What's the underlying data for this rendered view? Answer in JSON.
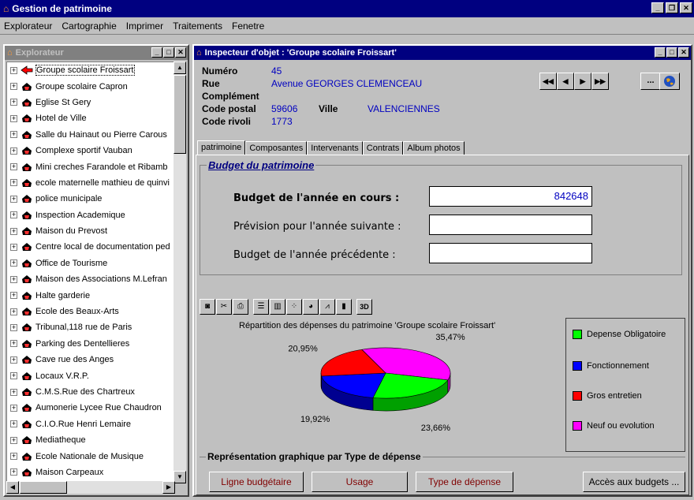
{
  "app": {
    "title": "Gestion de patrimoine"
  },
  "menu": [
    "Explorateur",
    "Cartographie",
    "Imprimer",
    "Traitements",
    "Fenetre"
  ],
  "explorer": {
    "title": "Explorateur",
    "items": [
      "Groupe scolaire Froissart",
      "Groupe scolaire Capron",
      "Eglise St Gery",
      "Hotel de Ville",
      "Salle du Hainaut ou Pierre Carous",
      "Complexe sportif Vauban",
      "Mini creches Farandole et Ribamb",
      "ecole maternelle mathieu de quinvi",
      "police municipale",
      "Inspection Academique",
      "Maison du Prevost",
      "Centre local de documentation ped",
      "Office  de Tourisme",
      "Maison des Associations M.Lefran",
      "Halte garderie",
      "Ecole des Beaux-Arts",
      "Tribunal,118 rue de Paris",
      "Parking des Dentellieres",
      "Cave rue des Anges",
      "Locaux V.R.P.",
      "C.M.S.Rue des Chartreux",
      "Aumonerie Lycee Rue Chaudron",
      "C.I.O.Rue Henri Lemaire",
      "Mediatheque",
      "Ecole Nationale de Musique",
      "Maison Carpeaux"
    ]
  },
  "inspector": {
    "title": "Inspecteur d'objet : 'Groupe scolaire Froissart'",
    "numero_label": "Numéro",
    "numero": "45",
    "rue_label": "Rue",
    "rue": "Avenue GEORGES CLEMENCEAU",
    "complement_label": "Complément",
    "cp_label": "Code postal",
    "cp": "59606",
    "ville_label": "Ville",
    "ville": "VALENCIENNES",
    "rivoli_label": "Code rivoli",
    "rivoli": "1773",
    "nav": [
      "◀◀",
      "◀",
      "▶",
      "▶▶"
    ],
    "more": "..."
  },
  "tabs": [
    "patrimoine",
    "Composantes",
    "Intervenants",
    "Contrats",
    "Album photos"
  ],
  "budget": {
    "legend": "Budget du patrimoine",
    "current_label": "Budget de l'année en cours :",
    "current_value": "842648",
    "next_label": "Prévision pour l'année suivante :",
    "prev_label": "Budget de l'année précédente :"
  },
  "chart_data": {
    "type": "pie",
    "title": "Répartition des dépenses du patrimoine 'Groupe scolaire Froissart'",
    "categories": [
      "Neuf ou evolution",
      "Depense Obligatoire",
      "Fonctionnement",
      "Gros entretien"
    ],
    "values": [
      35.47,
      23.66,
      19.92,
      20.95
    ],
    "labels": [
      "35,47%",
      "23,66%",
      "19,92%",
      "20,95%"
    ],
    "colors": [
      "#ff00ff",
      "#00ff00",
      "#0000ff",
      "#ff0000"
    ],
    "legend": [
      {
        "label": "Depense Obligatoire",
        "color": "#00ff00"
      },
      {
        "label": "Fonctionnement",
        "color": "#0000ff"
      },
      {
        "label": "Gros entretien",
        "color": "#ff0000"
      },
      {
        "label": "Neuf ou evolution",
        "color": "#ff00ff"
      }
    ]
  },
  "repr": {
    "legend": "Représentation graphique par Type de dépense",
    "btn1": "Ligne budgétaire",
    "btn2": "Usage",
    "btn3": "Type de dépense",
    "btn4": "Accès aux budgets ..."
  }
}
